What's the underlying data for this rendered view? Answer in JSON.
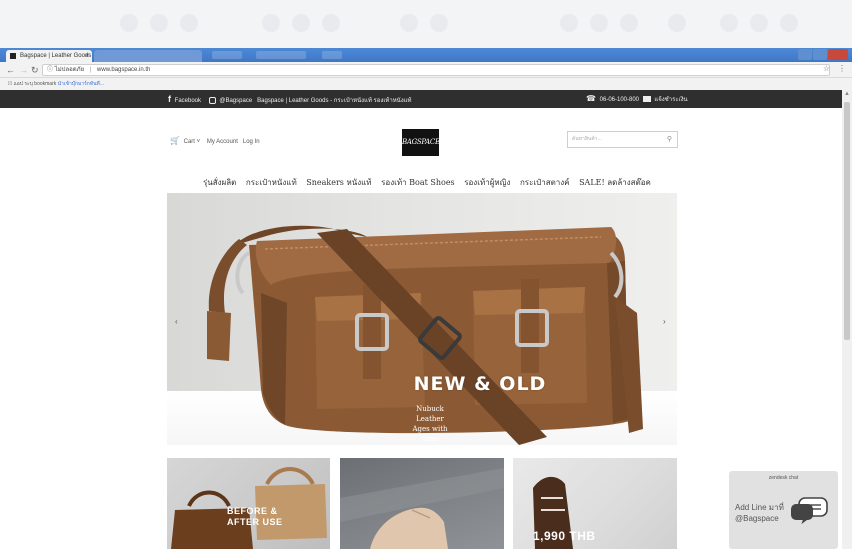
{
  "browser": {
    "active_tab_title": "Bagspace | Leather Goods",
    "active_tab_close": "×",
    "inactive_tab_title": "",
    "url_security": "ไม่ปลอดภัย",
    "url": "www.bagspace.in.th",
    "bookmarks_apps": "แอป",
    "bookmarks_prompt": "ระบุ bookmark",
    "bookmarks_link": "นำเข้าบุ๊กมาร์กทันที..."
  },
  "site": {
    "topbar": {
      "facebook": "Facebook",
      "line_id": "@Bagspace",
      "tagline": "Bagspace | Leather Goods - กระเป๋าหนังแท้ รองเท้าหนังแท้",
      "phone": "06-06-100-800",
      "payment": "แจ้งชำระเงิน"
    },
    "header": {
      "cart": "Cart",
      "my_account": "My Account",
      "login": "Log In",
      "logo": "BAGSPACE",
      "search_placeholder": "ค้นหาสินค้า..."
    },
    "nav": [
      "รุ่นสั่งผลิต",
      "กระเป๋าหนังแท้",
      "Sneakers หนังแท้",
      "รองเท้า Boat Shoes",
      "รองเท้าผู้หญิง",
      "กระเป๋าสตางค์",
      "SALE! ลดล้างสต๊อค"
    ],
    "hero": {
      "title": "NEW & OLD",
      "subtitle": "Nubuck Leather Ages with time",
      "prev": "‹",
      "next": "›"
    },
    "tiles": {
      "tile1_label": "BEFORE & AFTER USE",
      "tile3_price": "1,990 THB"
    },
    "chat": {
      "header": "zendesk chat",
      "text": "Add Line มาที่ @Bagspace"
    }
  },
  "colors": {
    "topbar_bg": "#2f2f2f",
    "tab_blue": "#4e89d6",
    "leather": "#8a5a35"
  }
}
